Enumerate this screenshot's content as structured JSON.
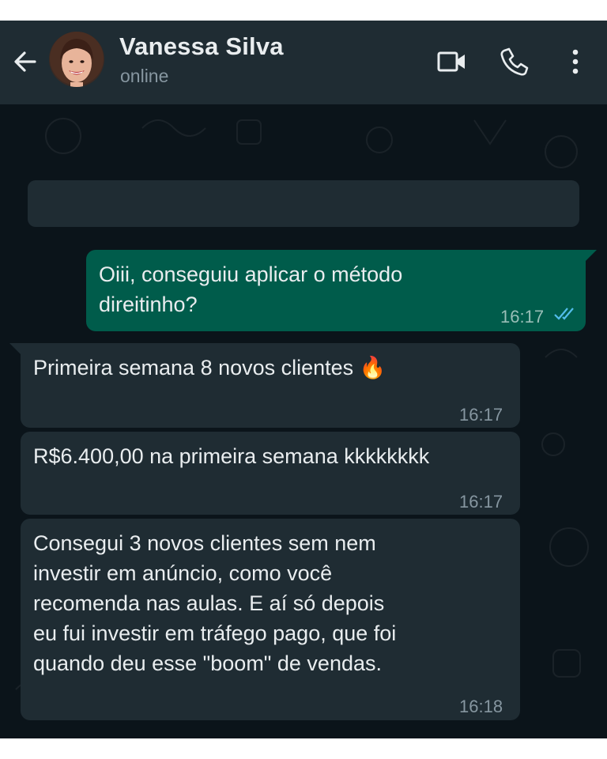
{
  "header": {
    "contact_name": "Vanessa Silva",
    "status": "online",
    "icons": [
      "back-arrow-icon",
      "video-call-icon",
      "voice-call-icon",
      "more-options-icon"
    ]
  },
  "colors": {
    "header_bg": "#1f2c33",
    "chat_bg": "#0b141a",
    "outgoing_bubble": "#005c4b",
    "incoming_bubble": "#1f2c33",
    "read_ticks": "#53bdeb"
  },
  "messages": [
    {
      "direction": "outgoing",
      "text": "Oiii, conseguiu aplicar o método\ndireitinho?",
      "time": "16:17",
      "status": "read"
    },
    {
      "direction": "incoming",
      "text": "Primeira semana 8 novos clientes 🔥",
      "time": "16:17"
    },
    {
      "direction": "incoming",
      "text": "R$6.400,00 na primeira semana kkkkkkkk",
      "time": "16:17"
    },
    {
      "direction": "incoming",
      "text": "Consegui 3 novos clientes sem nem\ninvestir em anúncio, como você\nrecomenda nas aulas. E aí só depois\neu fui investir em tráfego pago, que foi\nquando deu esse \"boom\" de vendas.",
      "time": "16:18"
    }
  ]
}
